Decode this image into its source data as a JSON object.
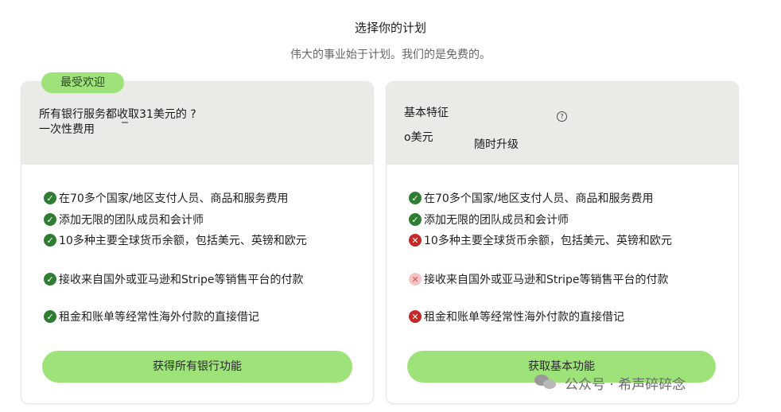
{
  "header": {
    "title": "选择你的计划",
    "subtitle": "伟大的事业始于计划。我们的是免费的。"
  },
  "left_plan": {
    "badge": "最受欢迎",
    "price_line1": "所有银行服务都收取31美元的 ?",
    "price_line2": "一次性费用",
    "features": [
      {
        "text": "在70多个国家/地区支付人员、商品和服务费用",
        "status": "check"
      },
      {
        "text": "添加无限的团队成员和会计师",
        "status": "check"
      },
      {
        "text": "10多种主要全球货币余额，包括美元、英镑和欧元",
        "status": "check"
      },
      {
        "text": "接收来自国外或亚马逊和Stripe等销售平台的付款",
        "status": "check"
      },
      {
        "text": "租金和账单等经常性海外付款的直接借记",
        "status": "check"
      }
    ],
    "cta": "获得所有银行功能"
  },
  "right_plan": {
    "title": "基本特征",
    "help_icon": "?",
    "price": "o美元",
    "upgrade": "随时升级",
    "features": [
      {
        "text": "在70多个国家/地区支付人员、商品和服务费用",
        "status": "check"
      },
      {
        "text": "添加无限的团队成员和会计师",
        "status": "check"
      },
      {
        "text": "10多种主要全球货币余额，包括美元、英镑和欧元",
        "status": "cross"
      },
      {
        "text": "接收来自国外或亚马逊和Stripe等销售平台的付款",
        "status": "cross-faded"
      },
      {
        "text": "租金和账单等经常性海外付款的直接借记",
        "status": "cross"
      }
    ],
    "cta": "获取基本功能"
  },
  "watermark": {
    "text": "公众号 · 希声碎碎念",
    "icon": "wechat-icon"
  },
  "colors": {
    "accent": "#9ee27a",
    "check": "#2e7d32",
    "cross": "#c62828",
    "card_top": "#e9ece6"
  }
}
